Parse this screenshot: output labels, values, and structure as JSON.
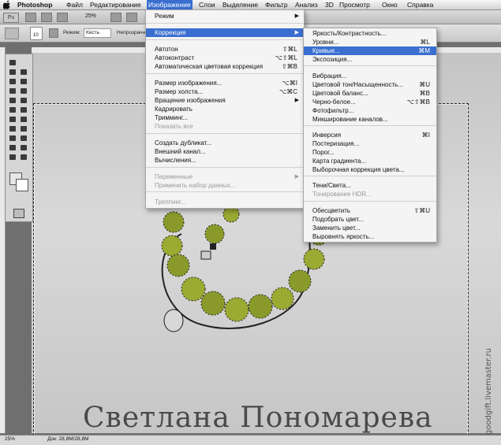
{
  "menubar": {
    "app": "Photoshop",
    "items": [
      "Файл",
      "Редактирование",
      "Изображение",
      "Слои",
      "Выделение",
      "Фильтр",
      "Анализ",
      "3D",
      "Просмотр",
      "Окно",
      "Справка"
    ]
  },
  "appbar": {
    "badge": "Ps",
    "zoom": "25%"
  },
  "optbar": {
    "brush_size": "10",
    "mode_label": "Режим:",
    "mode_value": "Кисть",
    "opacity_label": "Непрозрачн"
  },
  "image_menu": {
    "items": [
      {
        "label": "Режим",
        "shortcut": "",
        "submenu": true,
        "disabled": false
      },
      {
        "label": "Коррекция",
        "shortcut": "",
        "submenu": true,
        "disabled": false,
        "highlighted": true
      },
      {
        "label": "Автотон",
        "shortcut": "⇧⌘L",
        "submenu": false,
        "disabled": false
      },
      {
        "label": "Автоконтраст",
        "shortcut": "⌥⇧⌘L",
        "submenu": false,
        "disabled": false
      },
      {
        "label": "Автоматическая цветовая коррекция",
        "shortcut": "⇧⌘B",
        "submenu": false,
        "disabled": false
      },
      {
        "label": "Размер изображения...",
        "shortcut": "⌥⌘I",
        "submenu": false,
        "disabled": false
      },
      {
        "label": "Размер холста...",
        "shortcut": "⌥⌘C",
        "submenu": false,
        "disabled": false
      },
      {
        "label": "Вращение изображения",
        "shortcut": "",
        "submenu": true,
        "disabled": false
      },
      {
        "label": "Кадрировать",
        "shortcut": "",
        "submenu": false,
        "disabled": false
      },
      {
        "label": "Тримминг...",
        "shortcut": "",
        "submenu": false,
        "disabled": false
      },
      {
        "label": "Показать все",
        "shortcut": "",
        "submenu": false,
        "disabled": true
      },
      {
        "label": "Создать дубликат...",
        "shortcut": "",
        "submenu": false,
        "disabled": false
      },
      {
        "label": "Внешний канал...",
        "shortcut": "",
        "submenu": false,
        "disabled": false
      },
      {
        "label": "Вычисления...",
        "shortcut": "",
        "submenu": false,
        "disabled": false
      },
      {
        "label": "Переменные",
        "shortcut": "",
        "submenu": true,
        "disabled": true
      },
      {
        "label": "Применить набор данных...",
        "shortcut": "",
        "submenu": false,
        "disabled": true
      },
      {
        "label": "Треппинг...",
        "shortcut": "",
        "submenu": false,
        "disabled": true
      }
    ]
  },
  "adjust_menu": {
    "items": [
      {
        "label": "Яркость/Контрастность...",
        "shortcut": "",
        "disabled": false
      },
      {
        "label": "Уровни...",
        "shortcut": "⌘L",
        "disabled": false
      },
      {
        "label": "Кривые...",
        "shortcut": "⌘M",
        "disabled": false,
        "highlighted": true
      },
      {
        "label": "Экспозиция...",
        "shortcut": "",
        "disabled": false
      },
      {
        "label": "Вибрация...",
        "shortcut": "",
        "disabled": false
      },
      {
        "label": "Цветовой тон/Насыщенность...",
        "shortcut": "⌘U",
        "disabled": false
      },
      {
        "label": "Цветовой баланс...",
        "shortcut": "⌘B",
        "disabled": false
      },
      {
        "label": "Черно-белое...",
        "shortcut": "⌥⇧⌘B",
        "disabled": false
      },
      {
        "label": "Фотофильтр...",
        "shortcut": "",
        "disabled": false
      },
      {
        "label": "Микширование каналов...",
        "shortcut": "",
        "disabled": false
      },
      {
        "label": "Инверсия",
        "shortcut": "⌘I",
        "disabled": false
      },
      {
        "label": "Постеризация...",
        "shortcut": "",
        "disabled": false
      },
      {
        "label": "Порог...",
        "shortcut": "",
        "disabled": false
      },
      {
        "label": "Карта градиента...",
        "shortcut": "",
        "disabled": false
      },
      {
        "label": "Выборочная коррекция цвета...",
        "shortcut": "",
        "disabled": false
      },
      {
        "label": "Тени/Света...",
        "shortcut": "",
        "disabled": false
      },
      {
        "label": "Тонирование HDR...",
        "shortcut": "",
        "disabled": true
      },
      {
        "label": "Обесцветить",
        "shortcut": "⇧⌘U",
        "disabled": false
      },
      {
        "label": "Подобрать цвет...",
        "shortcut": "",
        "disabled": false
      },
      {
        "label": "Заменить цвет...",
        "shortcut": "",
        "disabled": false
      },
      {
        "label": "Выровнять яркость...",
        "shortcut": "",
        "disabled": false
      }
    ]
  },
  "signature": "Светлана Пономарева",
  "watermark": "goodgift.livemaster.ru",
  "status": {
    "zoom": "25%",
    "doc": "Док: 28,8M/28,8M"
  },
  "colors": {
    "highlight": "#3a6fd0",
    "menu_bg": "#f4f4f4"
  }
}
